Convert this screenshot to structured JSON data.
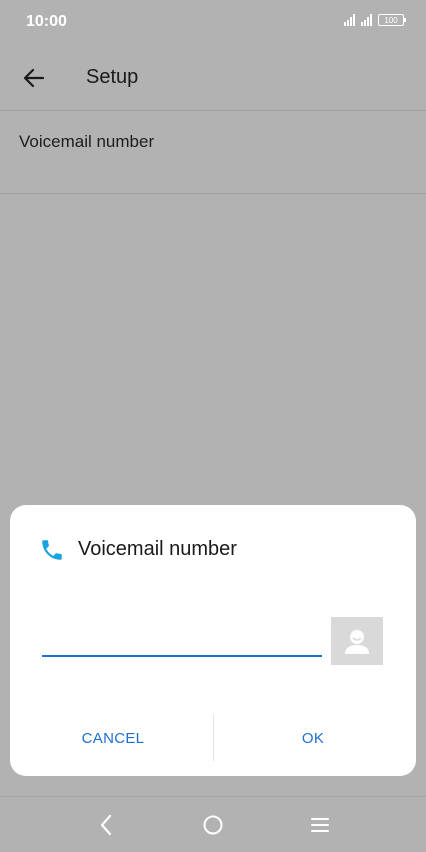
{
  "status_bar": {
    "time": "10:00",
    "battery": "100"
  },
  "app_bar": {
    "title": "Setup",
    "back_icon": "arrow-back-icon"
  },
  "preference": {
    "label": "Voicemail number"
  },
  "dialog": {
    "icon": "phone-icon",
    "title": "Voicemail number",
    "input_value": "",
    "contact_icon": "contact-picker-icon",
    "cancel_label": "CANCEL",
    "ok_label": "OK"
  },
  "nav_bar": {
    "back_icon": "nav-back-icon",
    "home_icon": "nav-home-icon",
    "menu_icon": "nav-menu-icon"
  },
  "colors": {
    "scrim": "#b2b2b2",
    "accent": "#1c6fd0",
    "phone_icon": "#1aa3e0",
    "dialog_bg": "#ffffff"
  }
}
